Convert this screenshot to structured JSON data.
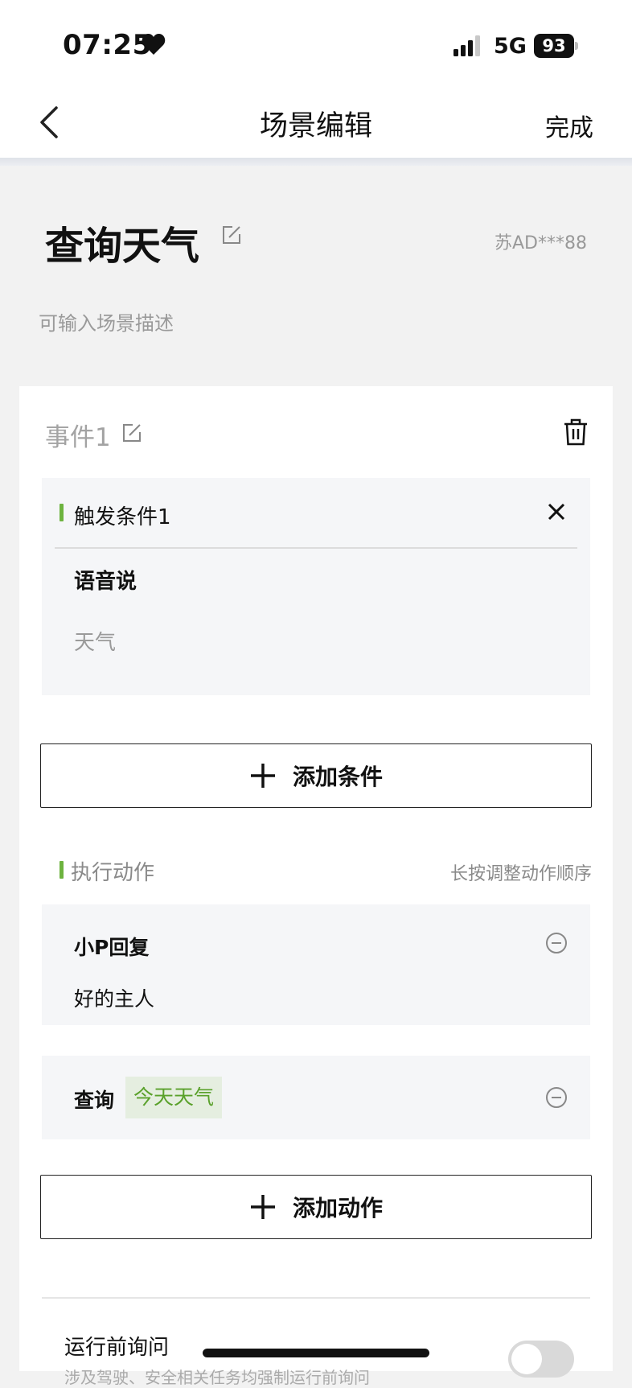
{
  "status_bar": {
    "time": "07:25",
    "network": "5G",
    "battery": "93",
    "icons": [
      "heart-icon",
      "signal-icon",
      "battery-icon"
    ]
  },
  "nav": {
    "title": "场景编辑",
    "done_label": "完成",
    "back_icon": "chevron-left-icon"
  },
  "scene": {
    "title": "查询天气",
    "plate": "苏AD***88",
    "description_placeholder": "可输入场景描述"
  },
  "event": {
    "title": "事件1",
    "condition": {
      "label": "触发条件1",
      "type": "语音说",
      "value": "天气"
    },
    "add_condition_label": "添加条件",
    "actions_label": "执行动作",
    "actions_hint": "长按调整动作顺序",
    "actions": [
      {
        "title": "小P回复",
        "text": "好的主人"
      },
      {
        "title": "查询",
        "tag": "今天天气"
      }
    ],
    "add_action_label": "添加动作",
    "ask_before_run": {
      "label": "运行前询问",
      "subtext": "涉及驾驶、安全相关任务均强制运行前询问",
      "enabled": false
    }
  },
  "colors": {
    "accent_green": "#6db33f",
    "tag_background": "#e5eee0",
    "tag_text": "#5aa12b",
    "page_background": "#f2f2f2",
    "card_background": "#ffffff",
    "inner_box_background": "#f5f6f8"
  }
}
